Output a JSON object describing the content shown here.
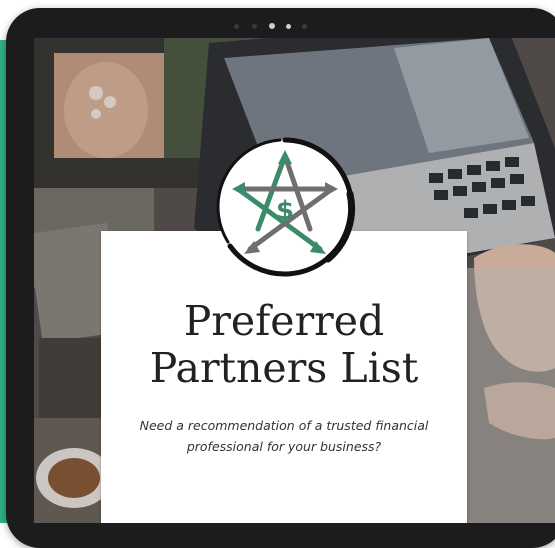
{
  "title_line1": "Preferred",
  "title_line2": "Partners List",
  "subtitle": "Need a recommendation of a trusted financial professional for your business?",
  "logo_symbol": "$",
  "colors": {
    "accent": "#2fb287",
    "logo_green": "#3d8a6a",
    "logo_grey": "#6f6f6f",
    "text": "#222222",
    "device": "#1c1c1e"
  },
  "icons": [
    "star-dollar-logo"
  ]
}
